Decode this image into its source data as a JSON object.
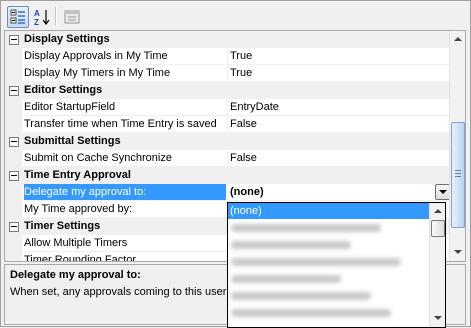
{
  "toolbar": {
    "buttons": [
      {
        "name": "categorized-view-button",
        "icon": "categorized-icon",
        "pressed": true
      },
      {
        "name": "alphabetical-view-button",
        "icon": "sort-az-icon",
        "pressed": false
      },
      {
        "name": "property-pages-button",
        "icon": "property-pages-icon",
        "pressed": false
      }
    ],
    "sort_label": "A Z"
  },
  "grid": {
    "rows": [
      {
        "type": "category",
        "label": "Display Settings"
      },
      {
        "type": "property",
        "label": "Display Approvals in My Time",
        "value": "True"
      },
      {
        "type": "property",
        "label": "Display My Timers in My Time",
        "value": "True"
      },
      {
        "type": "category",
        "label": "Editor Settings"
      },
      {
        "type": "property",
        "label": "Editor StartupField",
        "value": "EntryDate"
      },
      {
        "type": "property",
        "label": "Transfer time when Time Entry is saved",
        "value": "False"
      },
      {
        "type": "category",
        "label": "Submittal Settings"
      },
      {
        "type": "property",
        "label": "Submit on Cache Synchronize",
        "value": "False"
      },
      {
        "type": "category",
        "label": "Time Entry Approval"
      },
      {
        "type": "property",
        "label": "Delegate my approval to:",
        "value": "(none)",
        "selected": true
      },
      {
        "type": "property",
        "label": "My Time approved by:",
        "value": ""
      },
      {
        "type": "category",
        "label": "Timer Settings"
      },
      {
        "type": "property",
        "label": "Allow Multiple Timers",
        "value": ""
      },
      {
        "type": "property",
        "label": "Timer Rounding Factor",
        "value": ""
      }
    ]
  },
  "dropdown": {
    "selected": "(none)",
    "options": [
      "(none)"
    ],
    "blurred_count": 7
  },
  "help": {
    "title": "Delegate my approval to:",
    "description": "When set, any approvals coming to this user"
  },
  "colors": {
    "selection": "#3399ff",
    "category_bg": "#f0f0f0"
  }
}
